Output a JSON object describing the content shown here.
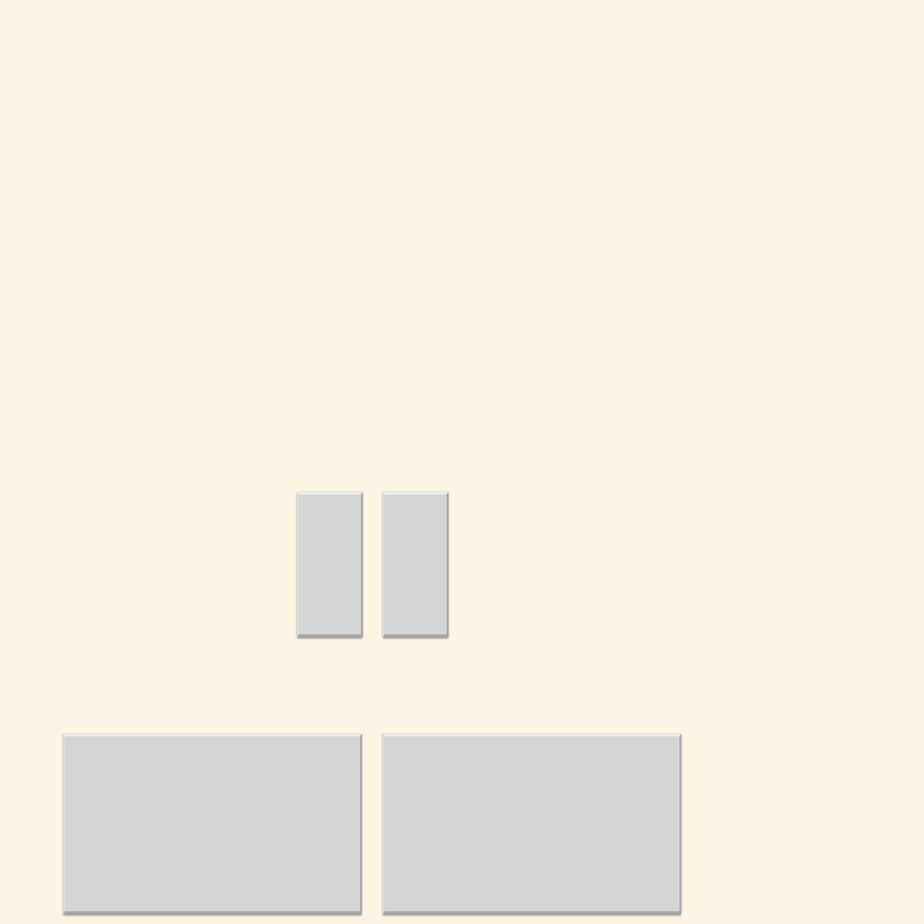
{
  "colors": {
    "background": "#fdf5e3",
    "block_fill": "#d4d4d4"
  },
  "blocks": [
    {
      "name": "block-small-left",
      "shape": "tall-rectangle"
    },
    {
      "name": "block-small-right",
      "shape": "tall-rectangle"
    },
    {
      "name": "block-large-left",
      "shape": "wide-rectangle"
    },
    {
      "name": "block-large-right",
      "shape": "wide-rectangle"
    }
  ]
}
